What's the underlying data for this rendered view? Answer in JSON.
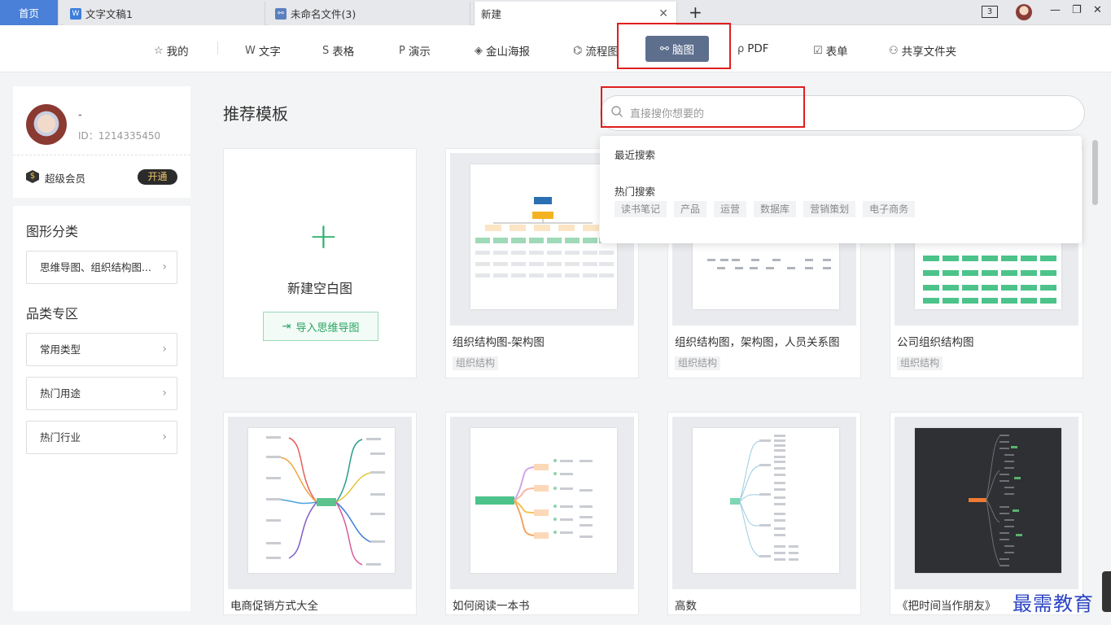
{
  "tabs": {
    "home": "首页",
    "doc": "文字文稿1",
    "unnamed": "未命名文件(3)",
    "new": "新建",
    "window_count": "3"
  },
  "nav": [
    {
      "icon": "star-icon",
      "glyph": "☆",
      "label": "我的"
    },
    {
      "icon": "writer-icon",
      "glyph": "W",
      "label": "文字"
    },
    {
      "icon": "sheet-icon",
      "glyph": "S",
      "label": "表格"
    },
    {
      "icon": "presentation-icon",
      "glyph": "P",
      "label": "演示"
    },
    {
      "icon": "poster-icon",
      "glyph": "◈",
      "label": "金山海报"
    },
    {
      "icon": "flowchart-icon",
      "glyph": "⌬",
      "label": "流程图"
    },
    {
      "icon": "mindmap-icon",
      "glyph": "⚯",
      "label": "脑图"
    },
    {
      "icon": "pdf-icon",
      "glyph": "ρ",
      "label": "PDF"
    },
    {
      "icon": "form-icon",
      "glyph": "☑",
      "label": "表单"
    },
    {
      "icon": "shared-folder-icon",
      "glyph": "⚇",
      "label": "共享文件夹"
    }
  ],
  "profile": {
    "name": "-",
    "id": "ID：1214335450",
    "vip_label": "超级会员",
    "open_label": "开通"
  },
  "sidebar": {
    "graphic_heading": "图形分类",
    "graphic_item": "思维导图、组织结构图...",
    "category_heading": "品类专区",
    "categories": [
      "常用类型",
      "热门用途",
      "热门行业"
    ]
  },
  "main": {
    "title": "推荐模板",
    "search_placeholder": "直接搜你想要的",
    "blank_title": "新建空白图",
    "import_label": "导入思维导图"
  },
  "dropdown": {
    "recent_label": "最近搜索",
    "hot_label": "热门搜索",
    "hot_terms": [
      "读书笔记",
      "产品",
      "运营",
      "数据库",
      "营销策划",
      "电子商务"
    ]
  },
  "templates": [
    {
      "title": "组织结构图-架构图",
      "tag": "组织结构"
    },
    {
      "title": "组织结构图，架构图，人员关系图",
      "tag": "组织结构"
    },
    {
      "title": "公司组织结构图",
      "tag": "组织结构"
    },
    {
      "title": "电商促销方式大全",
      "tag": ""
    },
    {
      "title": "如何阅读一本书",
      "tag": ""
    },
    {
      "title": "高数",
      "tag": ""
    },
    {
      "title": "《把时间当作朋友》",
      "tag": ""
    }
  ],
  "watermark": "最需教育",
  "colors": {
    "accent_blue": "#4a80d8",
    "active_nav": "#5e6f8e",
    "green": "#2bb06a",
    "highlight_red": "#e01e1e"
  }
}
